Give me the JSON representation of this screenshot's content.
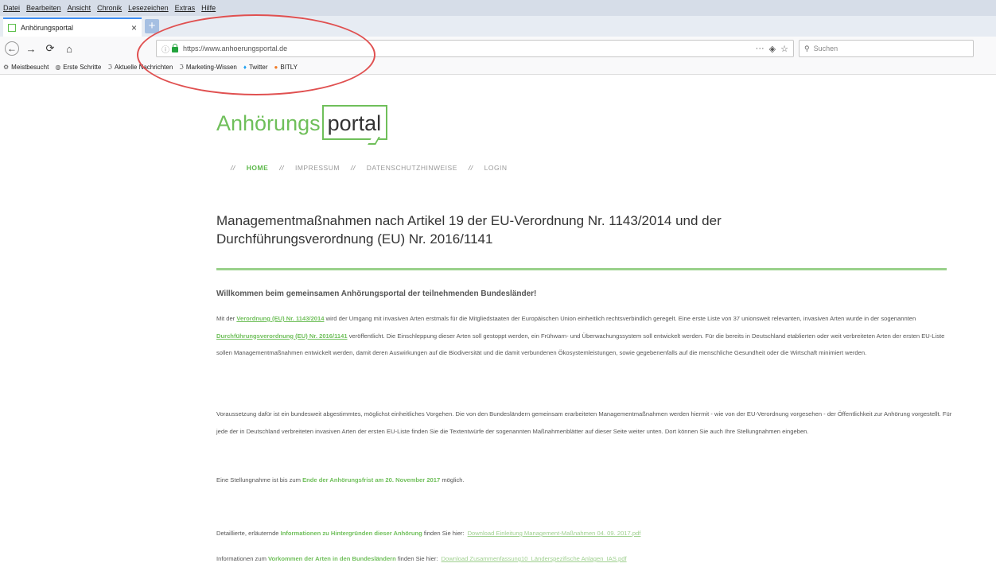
{
  "browser": {
    "menu": [
      "Datei",
      "Bearbeiten",
      "Ansicht",
      "Chronik",
      "Lesezeichen",
      "Extras",
      "Hilfe"
    ],
    "tab_title": "Anhörungsportal",
    "url": "https://www.anhoerungsportal.de",
    "search_placeholder": "Suchen",
    "bookmarks": [
      "Meistbesucht",
      "Erste Schritte",
      "Aktuelle Nachrichten",
      "Marketing-Wissen",
      "Twitter",
      "BITLY"
    ],
    "annotation_color": "#e05050"
  },
  "logo": {
    "part1": "Anhörungs",
    "part2": "portal"
  },
  "nav": {
    "sep": "//",
    "items": [
      "HOME",
      "IMPRESSUM",
      "DATENSCHUTZHINWEISE",
      "LOGIN"
    ]
  },
  "heading": "Managementmaßnahmen nach Artikel 19 der EU-Verordnung Nr. 1143/2014 und der Durchführungsverordnung (EU) Nr. 2016/1141",
  "welcome": "Willkommen beim gemeinsamen Anhörungsportal der teilnehmenden Bundesländer!",
  "p1": {
    "a": "Mit der ",
    "link1": "Verordnung (EU) Nr. 1143/2014",
    "b": " wird der Umgang mit invasiven Arten erstmals für die Mitgliedstaaten der Europäischen Union einheitlich rechtsverbindlich geregelt. Eine erste Liste von 37 unionsweit relevanten, invasiven Arten wurde in der sogenannten ",
    "link2": "Durchführungsverordnung (EU) Nr. 2016/1141",
    "c": " veröffentlicht. Die Einschleppung dieser Arten soll gestoppt werden, ein Frühwarn- und Überwachungssystem soll entwickelt werden. Für die bereits in Deutschland etablierten oder weit verbreiteten Arten der ersten EU-Liste sollen Managementmaßnahmen entwickelt werden, damit deren Auswirkungen auf die Biodiversität und die damit verbundenen Ökosystemleistungen, sowie gegebenenfalls auf die menschliche Gesundheit oder die Wirtschaft minimiert werden."
  },
  "p2": "Voraussetzung dafür ist ein bundesweit abgestimmtes, möglichst einheitliches Vorgehen. Die von den Bundesländern gemeinsam erarbeiteten Managementmaßnahmen werden hiermit - wie von der EU-Verordnung vorgesehen - der Öffentlichkeit zur Anhörung vorgestellt. Für jede der in Deutschland verbreiteten invasiven Arten der ersten EU-Liste finden Sie die Textentwürfe der sogenannten Maßnahmenblätter auf dieser Seite weiter unten. Dort können Sie auch Ihre Stellungnahmen eingeben.",
  "p3": {
    "a": "Eine Stellungnahme ist bis zum ",
    "b": "Ende der Anhörungsfrist am 20. November 2017",
    "c": " möglich."
  },
  "p4": {
    "a": "Detaillierte, erläuternde ",
    "b": "Informationen zu Hintergründen dieser Anhörung",
    "c": " finden Sie hier:",
    "link": "Download Einleitung Management-Maßnahmen 04. 09. 2017.pdf"
  },
  "p5": {
    "a": "Informationen zum ",
    "b": "Vorkommen der Arten in den Bundesländern",
    "c": " finden Sie hier:",
    "link": "Download Zusammenfassung10_Länderspezifische Anlagen_IAS.pdf"
  }
}
